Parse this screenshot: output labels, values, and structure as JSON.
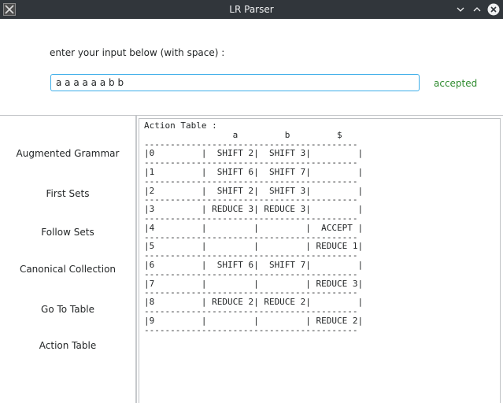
{
  "window": {
    "title": "LR Parser"
  },
  "input": {
    "prompt": "enter your input below (with space) :",
    "value": "a a a a a a b b",
    "status": "accepted"
  },
  "sidebar": {
    "items": [
      {
        "label": "Augmented Grammar"
      },
      {
        "label": "First Sets"
      },
      {
        "label": "Follow Sets"
      },
      {
        "label": "Canonical Collection"
      },
      {
        "label": "Go To Table"
      },
      {
        "label": "Action Table"
      }
    ]
  },
  "output": {
    "text": "Action Table :\n                 a         b         $\n-----------------------------------------\n|0         |  SHIFT 2|  SHIFT 3|         |\n-----------------------------------------\n|1         |  SHIFT 6|  SHIFT 7|         |\n-----------------------------------------\n|2         |  SHIFT 2|  SHIFT 3|         |\n-----------------------------------------\n|3         | REDUCE 3| REDUCE 3|         |\n-----------------------------------------\n|4         |         |         |  ACCEPT |\n-----------------------------------------\n|5         |         |         | REDUCE 1|\n-----------------------------------------\n|6         |  SHIFT 6|  SHIFT 7|         |\n-----------------------------------------\n|7         |         |         | REDUCE 3|\n-----------------------------------------\n|8         | REDUCE 2| REDUCE 2|         |\n-----------------------------------------\n|9         |         |         | REDUCE 2|\n-----------------------------------------"
  },
  "colors": {
    "titlebar": "#31363b",
    "accent": "#3daee9",
    "status_ok": "#2e8b2e"
  }
}
